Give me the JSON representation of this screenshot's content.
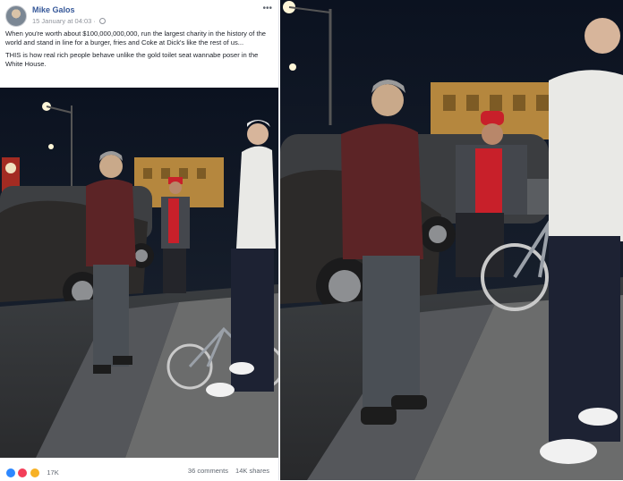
{
  "post": {
    "author": "Mike Galos",
    "timestamp": "15 January at 04:03",
    "paragraph1": "When you're worth about $100,000,000,000, run the largest charity in the history of the world and stand in line for a burger, fries and Coke at Dick's like the rest of us...",
    "paragraph2": "THIS is how real rich people behave unlike the gold toilet seat wannabe poser in the White House.",
    "reaction_count": "17K",
    "comments": "36 comments",
    "shares": "14K shares",
    "reaction_icons": [
      "like-icon",
      "love-icon",
      "haha-icon"
    ],
    "accent_color": "#365899"
  },
  "photo": {
    "description_icons": [
      "photo-icon"
    ],
    "colors": {
      "sky": "#0e1524",
      "building": "#b5873e",
      "jacket": "#5c2426",
      "pants": "#4a4f55",
      "shirt": "#e9e9e6"
    }
  }
}
